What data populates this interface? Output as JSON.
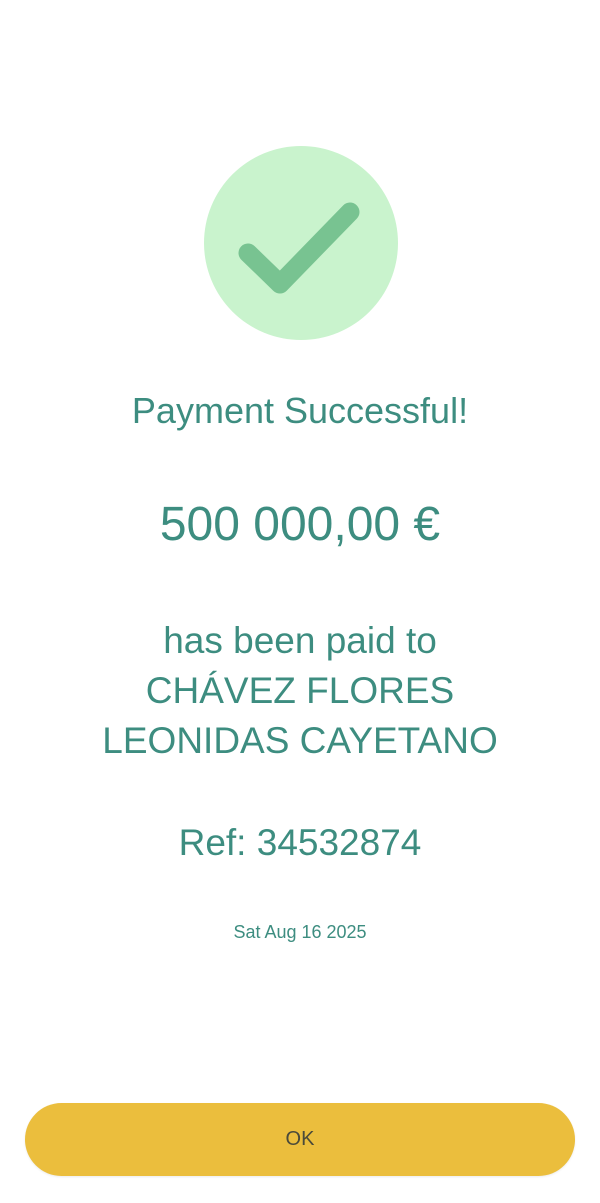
{
  "status_icon": "checkmark-icon",
  "colors": {
    "accent_text": "#3d8d80",
    "success_circle": "#c9f3cd",
    "checkmark": "#78c391",
    "button": "#ebbe3d"
  },
  "title": "Payment Successful!",
  "amount": "500 000,00 €",
  "paid_to_label": "has been paid to",
  "recipient": {
    "line1": "CHÁVEZ FLORES",
    "line2": "LEONIDAS CAYETANO"
  },
  "reference": "Ref: 34532874",
  "date": "Sat Aug 16 2025",
  "ok_button": {
    "label": "OK"
  }
}
